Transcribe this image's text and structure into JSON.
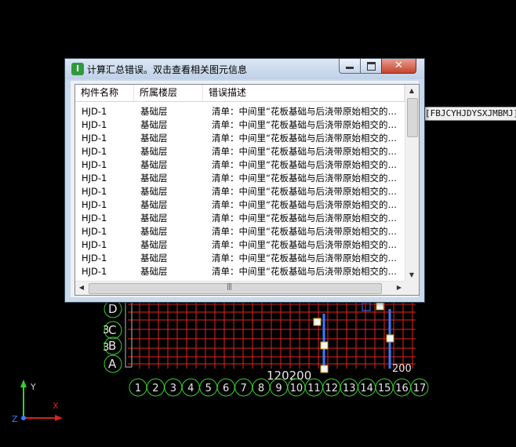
{
  "dialog": {
    "title": "计算汇总错误。双击查看相关图元信息",
    "icon": "app-logo-icon",
    "buttons": {
      "minimize": "minimize-icon",
      "maximize": "maximize-icon",
      "close": "close-icon"
    },
    "columns": [
      "构件名称",
      "所属楼层",
      "错误描述"
    ],
    "rows": [
      [
        "HJD-1",
        "基础层",
        "清单：中间里“花板基础与后浇带原始相交的…"
      ],
      [
        "HJD-1",
        "基础层",
        "清单：中间里“花板基础与后浇带原始相交的…"
      ],
      [
        "HJD-1",
        "基础层",
        "清单：中间里“花板基础与后浇带原始相交的…"
      ],
      [
        "HJD-1",
        "基础层",
        "清单：中间里“花板基础与后浇带原始相交的…"
      ],
      [
        "HJD-1",
        "基础层",
        "清单：中间里“花板基础与后浇带原始相交的…"
      ],
      [
        "HJD-1",
        "基础层",
        "清单：中间里“花板基础与后浇带原始相交的…"
      ],
      [
        "HJD-1",
        "基础层",
        "清单：中间里“花板基础与后浇带原始相交的…"
      ],
      [
        "HJD-1",
        "基础层",
        "清单：中间里“花板基础与后浇带原始相交的…"
      ],
      [
        "HJD-1",
        "基础层",
        "清单：中间里“花板基础与后浇带原始相交的…"
      ],
      [
        "HJD-1",
        "基础层",
        "清单：中间里“花板基础与后浇带原始相交的…"
      ],
      [
        "HJD-1",
        "基础层",
        "清单：中间里“花板基础与后浇带原始相交的…"
      ],
      [
        "HJD-1",
        "基础层",
        "清单：中间里“花板基础与后浇带原始相交的…"
      ],
      [
        "HJD-1",
        "基础层",
        "清单：中间里“花板基础与后浇带原始相交的…"
      ]
    ]
  },
  "cad": {
    "tooltip": "[FBJCYHJDYSXJMBMJ]\"",
    "row_labels": [
      "D",
      "C",
      "B",
      "A"
    ],
    "row_prefix": [
      "3",
      "3"
    ],
    "dimension_label": "120200",
    "dim_right": "200",
    "col_labels": [
      "1",
      "2",
      "3",
      "4",
      "5",
      "6",
      "7",
      "8",
      "9",
      "10",
      "11",
      "12",
      "13",
      "14",
      "15",
      "16",
      "17"
    ],
    "ucs_x": "X",
    "ucs_y": "Y",
    "ucs_z": "Z",
    "colors": {
      "grid": "#e52222",
      "label": "#39d12e",
      "wall": "#3a7bff",
      "bg": "#000000"
    }
  }
}
